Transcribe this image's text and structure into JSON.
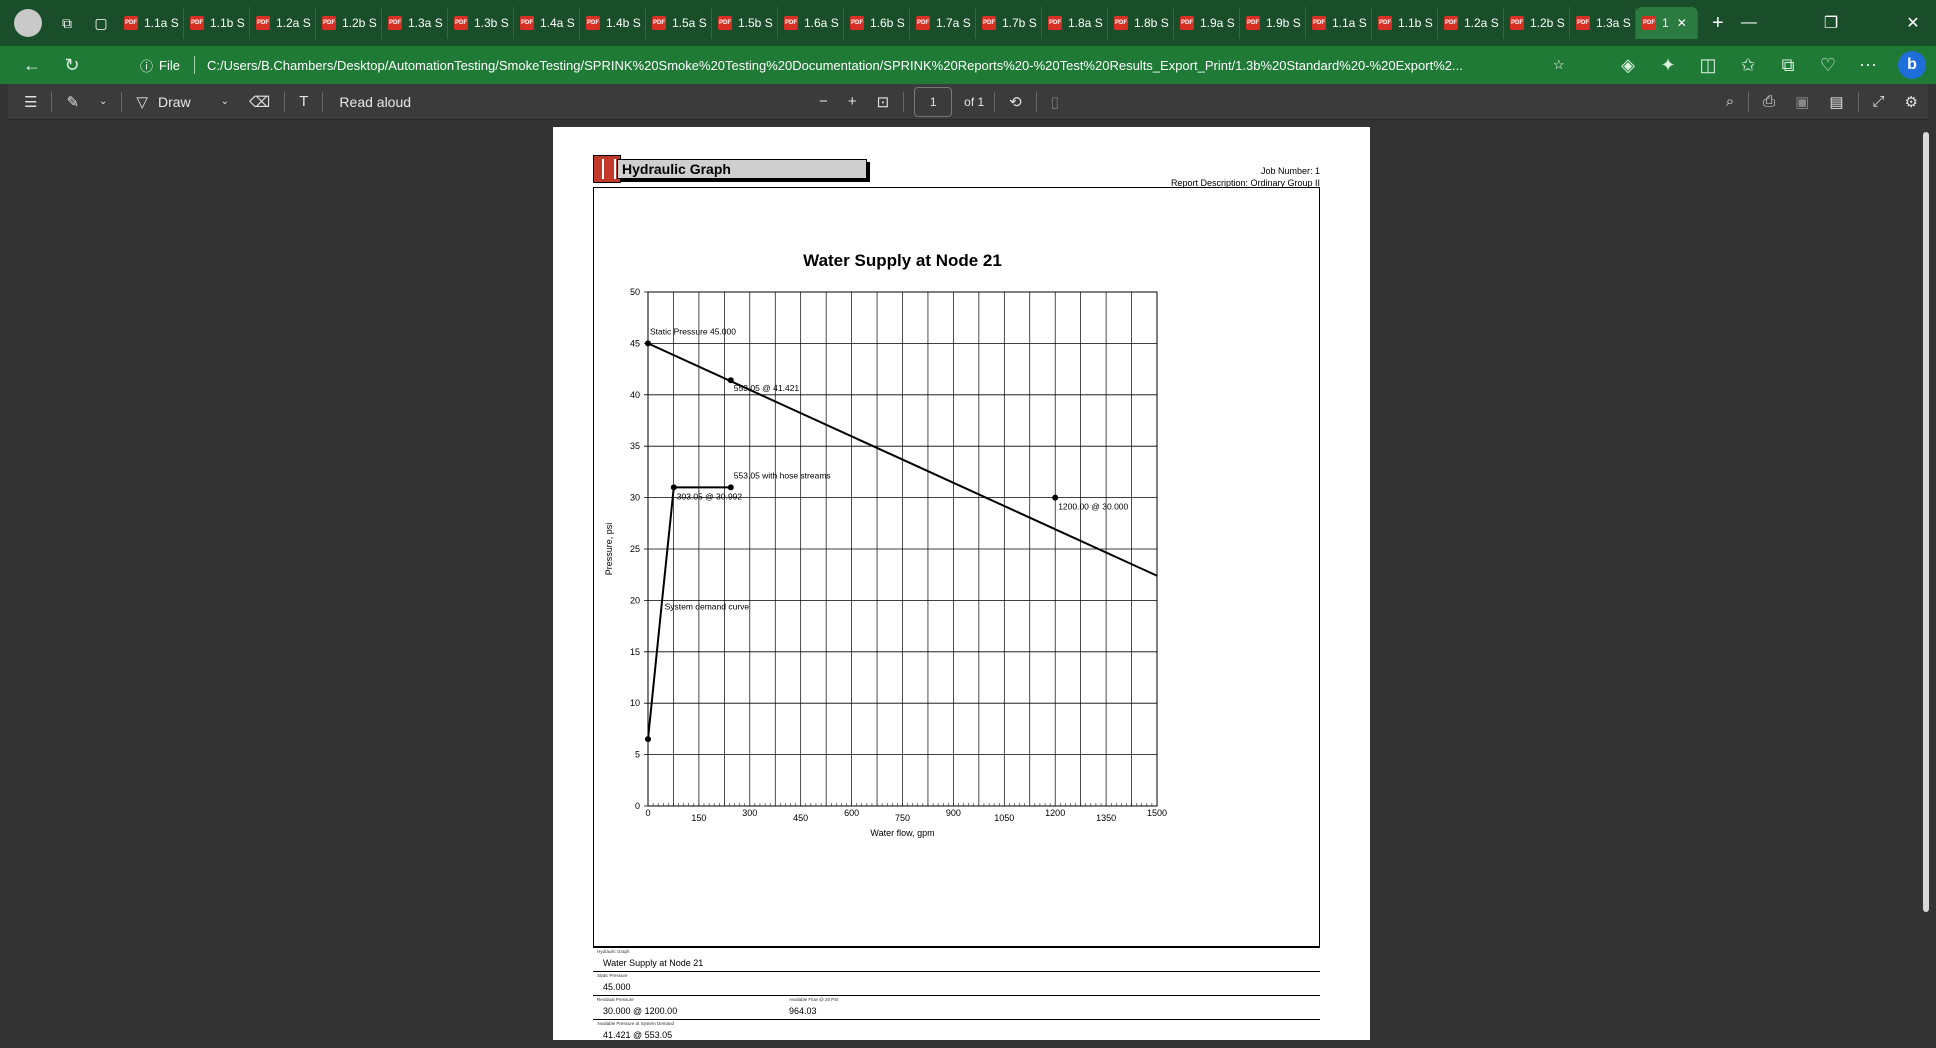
{
  "browser": {
    "tabs": [
      {
        "label": "1.1a S"
      },
      {
        "label": "1.1b S"
      },
      {
        "label": "1.2a S"
      },
      {
        "label": "1.2b S"
      },
      {
        "label": "1.3a S"
      },
      {
        "label": "1.3b S"
      },
      {
        "label": "1.4a S"
      },
      {
        "label": "1.4b S"
      },
      {
        "label": "1.5a S"
      },
      {
        "label": "1.5b S"
      },
      {
        "label": "1.6a S"
      },
      {
        "label": "1.6b S"
      },
      {
        "label": "1.7a S"
      },
      {
        "label": "1.7b S"
      },
      {
        "label": "1.8a S"
      },
      {
        "label": "1.8b S"
      },
      {
        "label": "1.9a S"
      },
      {
        "label": "1.9b S"
      },
      {
        "label": "1.1a S"
      },
      {
        "label": "1.1b S"
      },
      {
        "label": "1.2a S"
      },
      {
        "label": "1.2b S"
      },
      {
        "label": "1.3a S"
      }
    ],
    "active_tab": "1",
    "address_prefix": "File",
    "url": "C:/Users/B.Chambers/Desktop/AutomationTesting/SmokeTesting/SPRINK%20Smoke%20Testing%20Documentation/SPRINK%20Reports%20-%20Test%20Results_Export_Print/1.3b%20Standard%20-%20Export%2..."
  },
  "pdf_toolbar": {
    "draw_label": "Draw",
    "read_aloud_label": "Read aloud",
    "page_current": "1",
    "page_total": "of 1"
  },
  "report": {
    "header_title": "Hydraulic Graph",
    "job_number": "Job Number: 1",
    "report_description": "Report Description: Ordinary Group II"
  },
  "chart_data": {
    "type": "line",
    "title": "Water Supply at Node 21",
    "xlabel": "Water flow, gpm",
    "ylabel": "Pressure, psi",
    "xlim": [
      0,
      1500
    ],
    "ylim": [
      0,
      50
    ],
    "x_tick_labels": [
      {
        "value": 0,
        "label": "0"
      },
      {
        "value": 150,
        "label": "150"
      },
      {
        "value": 300,
        "label": "300"
      },
      {
        "value": 450,
        "label": "450"
      },
      {
        "value": 600,
        "label": "600"
      },
      {
        "value": 750,
        "label": "750"
      },
      {
        "value": 900,
        "label": "900"
      },
      {
        "value": 1050,
        "label": "1050"
      },
      {
        "value": 1200,
        "label": "1200"
      },
      {
        "value": 1350,
        "label": "1350"
      },
      {
        "value": 1500,
        "label": "1500"
      }
    ],
    "y_ticks": [
      0,
      5,
      10,
      15,
      20,
      25,
      30,
      35,
      40,
      45,
      50
    ],
    "grid": true,
    "series": [
      {
        "points": [
          [
            0,
            45
          ],
          [
            1500,
            22.4
          ]
        ]
      },
      {
        "points": [
          [
            0,
            6.5
          ],
          [
            40,
            19.5
          ],
          [
            76,
            30.992
          ],
          [
            244,
            30.992
          ]
        ]
      }
    ],
    "markers": [
      [
        0,
        45
      ],
      [
        244,
        41.421
      ],
      [
        76,
        30.992
      ],
      [
        244,
        30.992
      ],
      [
        1200,
        30
      ],
      [
        0,
        6.5
      ]
    ],
    "annotations": [
      {
        "text": "Static Pressure 45.000",
        "x": 0,
        "y": 45
      },
      {
        "text": "553.05 @ 41.421",
        "x": 244,
        "y": 41.421
      },
      {
        "text": "553.05 with hose streams",
        "x": 244,
        "y": 30.992
      },
      {
        "text": "303.05 @ 30.992",
        "x": 76,
        "y": 30.992
      },
      {
        "text": "1200.00 @ 30.000",
        "x": 1200,
        "y": 30
      },
      {
        "text": "System demand curve",
        "x": 40,
        "y": 19.5
      }
    ]
  },
  "summary": {
    "graph_label": "Hydraulic Graph",
    "graph_value": "Water Supply at Node 21",
    "static_label": "Static Pressure",
    "static_value": "45.000",
    "residual_label": "Residual Pressure",
    "residual_value": "30.000 @ 1200.00",
    "available_label": "Available Flow @ 20 PSI",
    "available_value": "964.03",
    "demand_label": "Available Pressure at System Demand",
    "demand_value": "41.421 @ 553.05"
  }
}
